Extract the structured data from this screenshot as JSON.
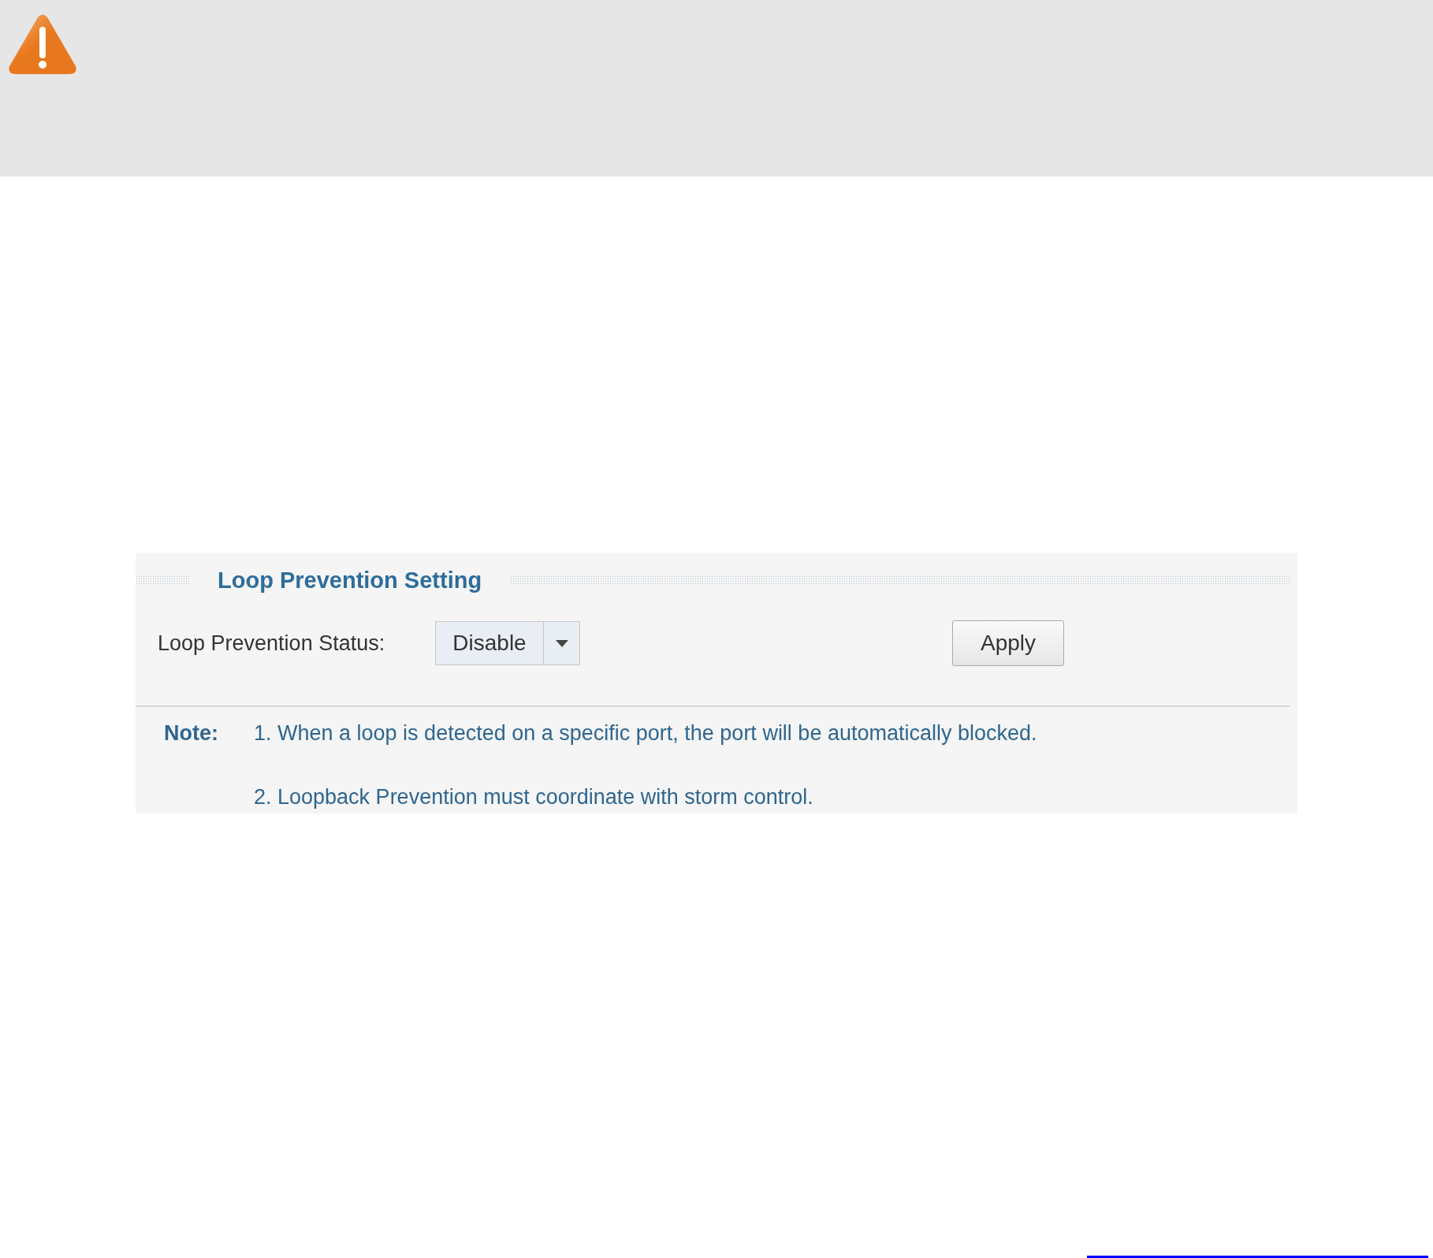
{
  "panel": {
    "title": "Loop Prevention Setting",
    "status": {
      "label": "Loop Prevention Status:",
      "value": "Disable"
    },
    "apply_button": "Apply",
    "note": {
      "label": "Note:",
      "items": [
        "1. When a loop is detected on a specific port, the port will be automatically blocked.",
        "2. Loopback Prevention must coordinate with storm control."
      ]
    }
  }
}
